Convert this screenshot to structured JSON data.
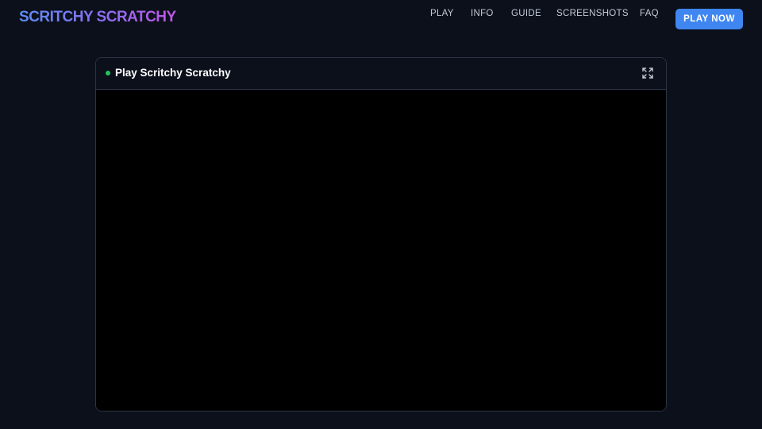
{
  "brand": {
    "logo": "SCRITCHY SCRATCHY"
  },
  "nav": {
    "items": [
      {
        "id": "play",
        "label": "PLAY"
      },
      {
        "id": "info",
        "label": "INFO"
      },
      {
        "id": "guide",
        "label": "GUIDE"
      },
      {
        "id": "screenshots",
        "label": "SCREENSHOTS"
      },
      {
        "id": "faq",
        "label": "FAQ"
      }
    ],
    "cta_label": "PLAY NOW"
  },
  "game_panel": {
    "title": "Play Scritchy Scratchy",
    "status_color": "#22c55e",
    "fullscreen_icon": "expand-icon"
  },
  "colors": {
    "background": "#0b101b",
    "accent": "#3f86f0",
    "logo_gradient": [
      "#5b8cf5",
      "#c154e6"
    ]
  }
}
